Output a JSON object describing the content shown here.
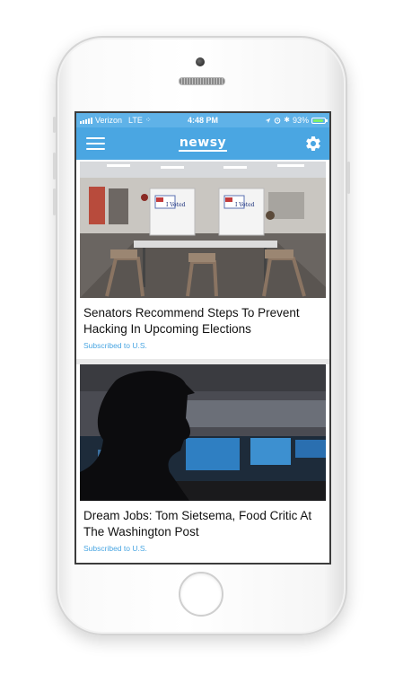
{
  "status_bar": {
    "carrier": "Verizon",
    "network": "LTE",
    "time": "4:48 PM",
    "bluetooth": "✱",
    "battery_percent": "93%",
    "battery_level": 0.93
  },
  "nav": {
    "logo": "newsy",
    "menu_icon": "hamburger-icon",
    "settings_icon": "gear-icon"
  },
  "colors": {
    "accent": "#4aa6e2",
    "battery": "#7ef06a"
  },
  "articles": [
    {
      "title": "Senators Recommend Steps To Prevent Hacking In Upcoming Elections",
      "subscription": "Subscribed to U.S.",
      "image": "voting-booths-photo",
      "booth_text": "I Voted"
    },
    {
      "title": "Dream Jobs: Tom Sietsema, Food Critic At The Washington Post",
      "subscription": "Subscribed to U.S.",
      "image": "silhouette-newsroom-photo"
    }
  ]
}
